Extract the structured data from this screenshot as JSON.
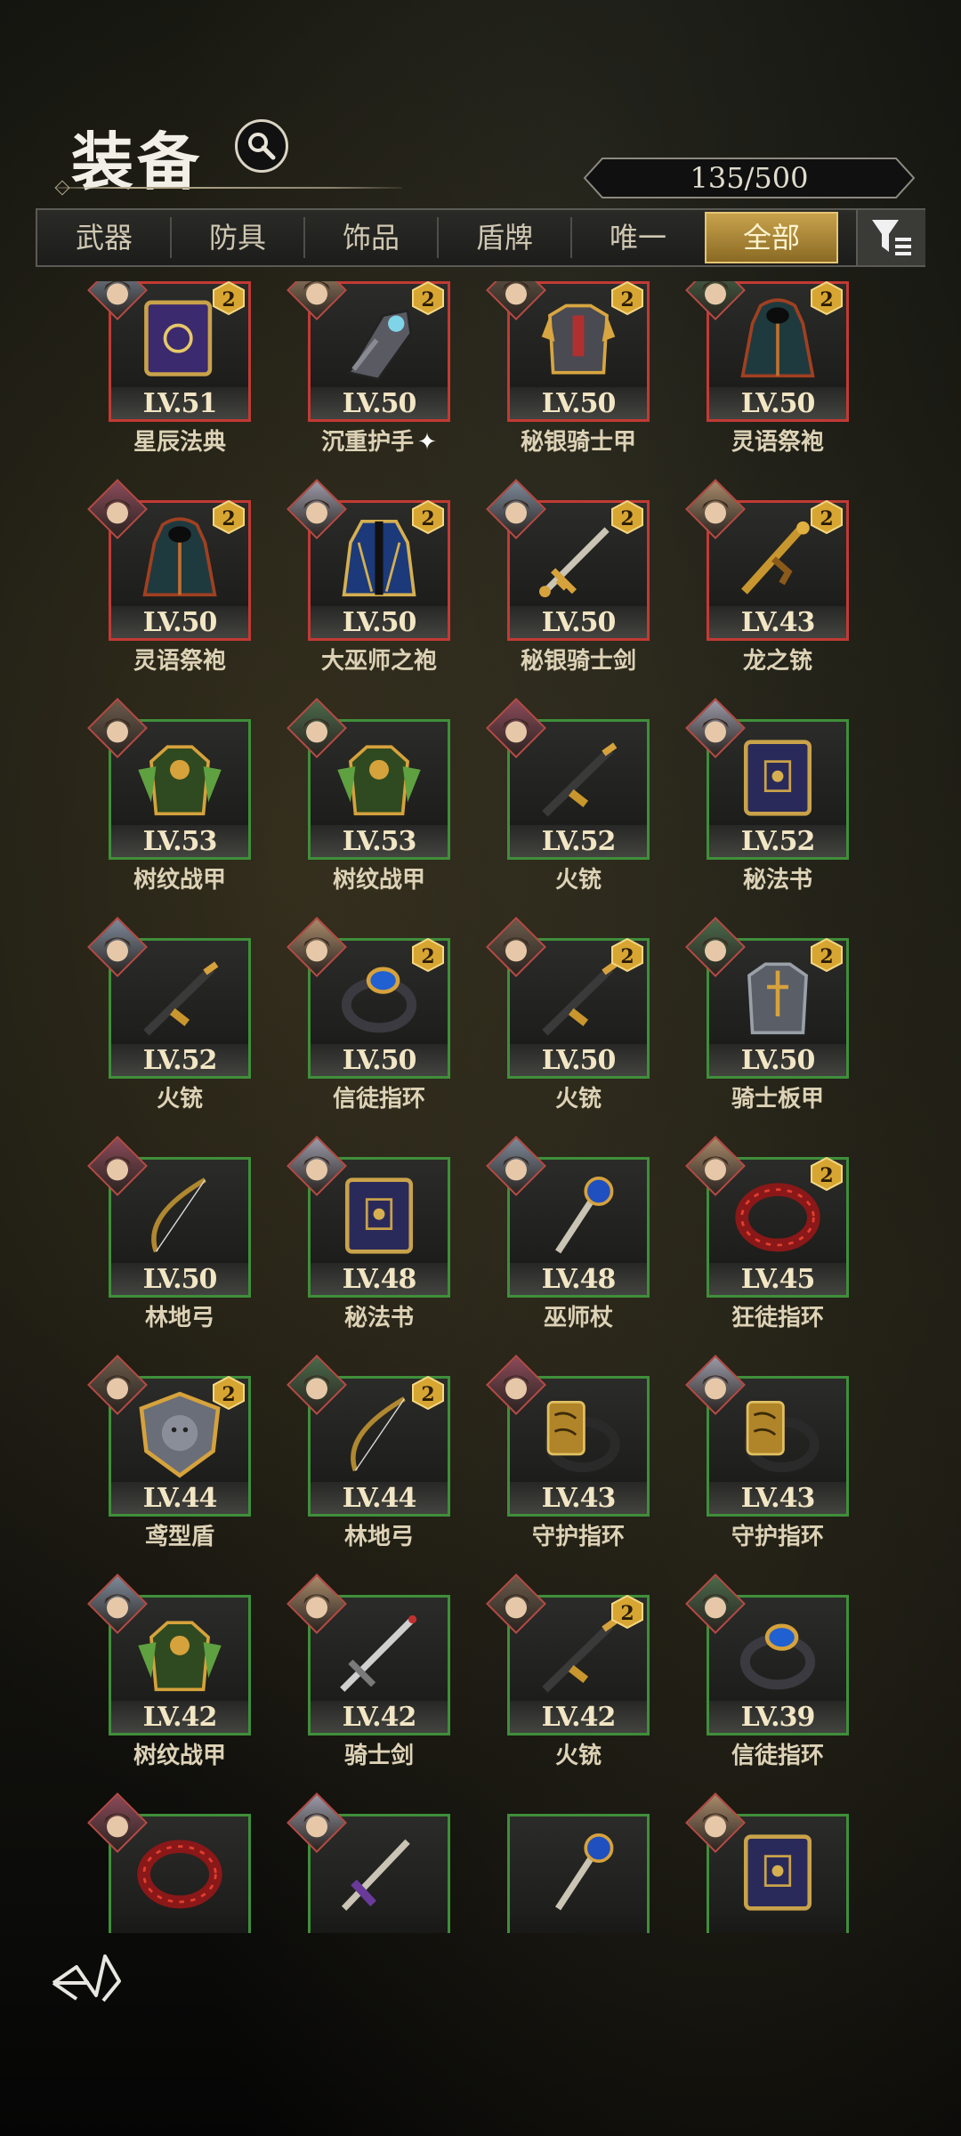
{
  "header": {
    "title": "装备",
    "capacity": "135/500"
  },
  "tabs": [
    {
      "label": "武器"
    },
    {
      "label": "防具"
    },
    {
      "label": "饰品"
    },
    {
      "label": "盾牌"
    },
    {
      "label": "唯一"
    },
    {
      "label": "全部"
    }
  ],
  "active_tab": "全部",
  "items": [
    {
      "name": "星辰法典",
      "level": "LV.51",
      "rarity": "red",
      "stars": "2",
      "icon": "purple-tome-icon"
    },
    {
      "name": "沉重护手",
      "level": "LV.50",
      "rarity": "red",
      "stars": "2",
      "icon": "gauntlet-icon",
      "marker": "✦"
    },
    {
      "name": "秘银骑士甲",
      "level": "LV.50",
      "rarity": "red",
      "stars": "2",
      "icon": "gold-plate-armor-icon"
    },
    {
      "name": "灵语祭袍",
      "level": "LV.50",
      "rarity": "red",
      "stars": "2",
      "icon": "dark-robe-icon"
    },
    {
      "name": "灵语祭袍",
      "level": "LV.50",
      "rarity": "red",
      "stars": "2",
      "icon": "dark-robe-icon"
    },
    {
      "name": "大巫师之袍",
      "level": "LV.50",
      "rarity": "red",
      "stars": "2",
      "icon": "archmage-robe-icon"
    },
    {
      "name": "秘银骑士剑",
      "level": "LV.50",
      "rarity": "red",
      "stars": "2",
      "icon": "gold-sword-icon"
    },
    {
      "name": "龙之铳",
      "level": "LV.43",
      "rarity": "red",
      "stars": "2",
      "icon": "dragon-gun-icon"
    },
    {
      "name": "树纹战甲",
      "level": "LV.53",
      "rarity": "green",
      "stars": "",
      "icon": "leaf-armor-icon"
    },
    {
      "name": "树纹战甲",
      "level": "LV.53",
      "rarity": "green",
      "stars": "",
      "icon": "leaf-armor-icon"
    },
    {
      "name": "火铳",
      "level": "LV.52",
      "rarity": "green",
      "stars": "",
      "icon": "musket-icon"
    },
    {
      "name": "秘法书",
      "level": "LV.52",
      "rarity": "green",
      "stars": "",
      "icon": "spellbook-icon"
    },
    {
      "name": "火铳",
      "level": "LV.52",
      "rarity": "green",
      "stars": "",
      "icon": "musket-icon"
    },
    {
      "name": "信徒指环",
      "level": "LV.50",
      "rarity": "green",
      "stars": "2",
      "icon": "blue-gem-ring-icon"
    },
    {
      "name": "火铳",
      "level": "LV.50",
      "rarity": "green",
      "stars": "2",
      "icon": "musket-icon"
    },
    {
      "name": "骑士板甲",
      "level": "LV.50",
      "rarity": "green",
      "stars": "2",
      "icon": "knight-plate-icon"
    },
    {
      "name": "林地弓",
      "level": "LV.50",
      "rarity": "green",
      "stars": "",
      "icon": "longbow-icon"
    },
    {
      "name": "秘法书",
      "level": "LV.48",
      "rarity": "green",
      "stars": "",
      "icon": "spellbook-icon"
    },
    {
      "name": "巫师杖",
      "level": "LV.48",
      "rarity": "green",
      "stars": "",
      "icon": "orb-staff-icon"
    },
    {
      "name": "狂徒指环",
      "level": "LV.45",
      "rarity": "green",
      "stars": "2",
      "icon": "red-ring-icon"
    },
    {
      "name": "鸢型盾",
      "level": "LV.44",
      "rarity": "green",
      "stars": "2",
      "icon": "lion-shield-icon"
    },
    {
      "name": "林地弓",
      "level": "LV.44",
      "rarity": "green",
      "stars": "2",
      "icon": "longbow-icon"
    },
    {
      "name": "守护指环",
      "level": "LV.43",
      "rarity": "green",
      "stars": "",
      "icon": "gold-band-ring-icon"
    },
    {
      "name": "守护指环",
      "level": "LV.43",
      "rarity": "green",
      "stars": "",
      "icon": "gold-band-ring-icon"
    },
    {
      "name": "树纹战甲",
      "level": "LV.42",
      "rarity": "green",
      "stars": "",
      "icon": "leaf-armor-icon"
    },
    {
      "name": "骑士剑",
      "level": "LV.42",
      "rarity": "green",
      "stars": "",
      "icon": "knight-sword-icon"
    },
    {
      "name": "火铳",
      "level": "LV.42",
      "rarity": "green",
      "stars": "2",
      "icon": "musket-icon"
    },
    {
      "name": "信徒指环",
      "level": "LV.39",
      "rarity": "green",
      "stars": "",
      "icon": "blue-gem-ring-icon"
    },
    {
      "name": "",
      "level": "",
      "rarity": "green",
      "stars": "",
      "icon": "red-ring-icon"
    },
    {
      "name": "",
      "level": "",
      "rarity": "green",
      "stars": "",
      "icon": "purple-sword-icon"
    },
    {
      "name": "",
      "level": "",
      "rarity": "green",
      "stars": "",
      "icon": "orb-staff-icon"
    },
    {
      "name": "",
      "level": "",
      "rarity": "green",
      "stars": "",
      "icon": "spellbook-icon"
    }
  ],
  "colors": {
    "rarity_red": "#c23a34",
    "rarity_green": "#3f8f3a",
    "active_tab_gold": "#c8a24c",
    "star_badge_gold": "#d7a531"
  }
}
